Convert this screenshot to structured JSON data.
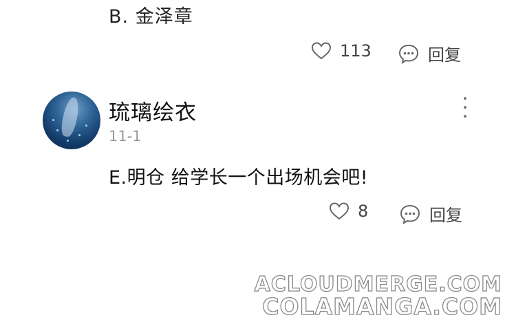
{
  "previous_comment": {
    "text": "B. 金泽章",
    "likes": "113",
    "reply_label": "回复"
  },
  "comment": {
    "username": "琉璃绘衣",
    "date": "11-1",
    "text": "E.明仓 给学长一个出场机会吧!",
    "likes": "8",
    "reply_label": "回复",
    "avatar_icon": "avatar-dolphin-night-sky"
  },
  "watermark": {
    "line1": "ACLOUDMERGE.COM",
    "line2": "COLAMANGA.COM"
  }
}
